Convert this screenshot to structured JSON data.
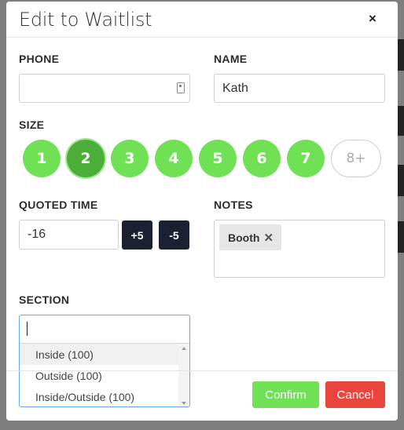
{
  "modal": {
    "title": "Edit to Waitlist",
    "close_glyph": "×"
  },
  "form": {
    "phone": {
      "label": "PHONE",
      "value": "",
      "placeholder": ""
    },
    "name": {
      "label": "NAME",
      "value": "Kath"
    },
    "size": {
      "label": "SIZE",
      "options": [
        "1",
        "2",
        "3",
        "4",
        "5",
        "6",
        "7"
      ],
      "selected": "2",
      "more_label": "8+"
    },
    "quoted_time": {
      "label": "QUOTED TIME",
      "value": "-16",
      "plus_label": "+5",
      "minus_label": "-5"
    },
    "notes": {
      "label": "NOTES",
      "tags": [
        {
          "label": "Booth",
          "remove_glyph": "✕"
        }
      ]
    },
    "section": {
      "label": "SECTION",
      "search_value": "",
      "options": [
        "Inside (100)",
        "Outside (100)",
        "Inside/Outside (100)"
      ],
      "highlighted_index": 0
    }
  },
  "footer": {
    "confirm_label": "Confirm",
    "cancel_label": "Cancel"
  },
  "colors": {
    "size_green": "#70e155",
    "size_selected": "#4aae39",
    "dark_button": "#1b2033",
    "confirm": "#70e155",
    "cancel": "#e9453d",
    "focus_border": "#6aa6e8"
  },
  "icons": {
    "phone_field": "contact-card-icon",
    "tag_remove": "close-icon",
    "scroll_up": "caret-up-icon",
    "scroll_down": "caret-down-icon"
  }
}
